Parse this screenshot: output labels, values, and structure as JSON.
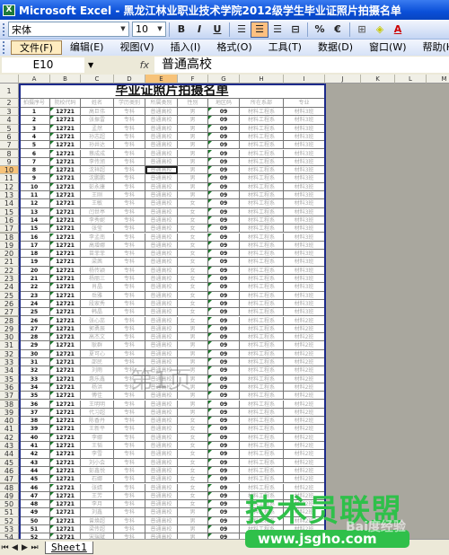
{
  "window": {
    "title": "Microsoft Excel - 黑龙江林业职业技术学院2012级学生毕业证照片拍摄名单",
    "app_icon": "excel-icon"
  },
  "format_toolbar": {
    "font": "宋体",
    "size": "10",
    "bold": "B",
    "italic": "I",
    "underline": "U",
    "percent": "%",
    "euro": "€"
  },
  "menu": [
    "文件(F)",
    "编辑(E)",
    "视图(V)",
    "插入(I)",
    "格式(O)",
    "工具(T)",
    "数据(D)",
    "窗口(W)",
    "帮助(H)"
  ],
  "formula_bar": {
    "name_box": "E10",
    "fx": "fx",
    "value": "普通高校"
  },
  "columns": [
    "A",
    "B",
    "C",
    "D",
    "E",
    "F",
    "G",
    "H",
    "I",
    "J",
    "K",
    "L",
    "M"
  ],
  "selected_cell": {
    "col": "E",
    "row": 10
  },
  "sheet_title": "毕业证照片拍摄名单",
  "headers": [
    "拍摄序号",
    "院校代码",
    "姓名",
    "学历类别",
    "所属类别",
    "性别",
    "地区码",
    "所在系部",
    "专业"
  ],
  "rows": [
    [
      "1",
      "12721",
      "高巨伟",
      "专科",
      "普通高校",
      "男",
      "09",
      "材料工程系",
      "材料3班"
    ],
    [
      "2",
      "12721",
      "张振雷",
      "专科",
      "普通高校",
      "男",
      "09",
      "材料工程系",
      "材料3班"
    ],
    [
      "3",
      "12721",
      "孟然",
      "专科",
      "普通高校",
      "男",
      "09",
      "材料工程系",
      "材料3班"
    ],
    [
      "4",
      "12721",
      "孙志超",
      "专科",
      "普通高校",
      "男",
      "09",
      "材料工程系",
      "材料3班"
    ],
    [
      "5",
      "12721",
      "孙井达",
      "专科",
      "普通高校",
      "男",
      "09",
      "材料工程系",
      "材料3班"
    ],
    [
      "6",
      "12721",
      "蔡成成",
      "专科",
      "普通高校",
      "男",
      "09",
      "材料工程系",
      "材料3班"
    ],
    [
      "7",
      "12721",
      "李传旭",
      "专科",
      "普通高校",
      "男",
      "09",
      "材料工程系",
      "材料3班"
    ],
    [
      "8",
      "12721",
      "沈祥超",
      "专科",
      "普通高校",
      "男",
      "09",
      "材料工程系",
      "材料3班"
    ],
    [
      "9",
      "12721",
      "沈鹏鹏",
      "专科",
      "普通高校",
      "男",
      "09",
      "材料工程系",
      "材料3班"
    ],
    [
      "10",
      "12721",
      "彭永康",
      "专科",
      "普通高校",
      "男",
      "09",
      "材料工程系",
      "材料3班"
    ],
    [
      "11",
      "12721",
      "王刚",
      "专科",
      "普通高校",
      "男",
      "09",
      "材料工程系",
      "材料3班"
    ],
    [
      "12",
      "12721",
      "王敏",
      "专科",
      "普通高校",
      "女",
      "09",
      "材料工程系",
      "材料3班"
    ],
    [
      "13",
      "12721",
      "闫世亭",
      "专科",
      "普通高校",
      "女",
      "09",
      "材料工程系",
      "材料3班"
    ],
    [
      "14",
      "12721",
      "李秀妮",
      "专科",
      "普通高校",
      "女",
      "09",
      "材料工程系",
      "材料3班"
    ],
    [
      "15",
      "12721",
      "张莹",
      "专科",
      "普通高校",
      "女",
      "09",
      "材料工程系",
      "材料3班"
    ],
    [
      "16",
      "12721",
      "李孟南",
      "专科",
      "普通高校",
      "女",
      "09",
      "材料工程系",
      "材料3班"
    ],
    [
      "17",
      "12721",
      "高增娜",
      "专科",
      "普通高校",
      "女",
      "09",
      "材料工程系",
      "材料3班"
    ],
    [
      "18",
      "12721",
      "苗菲菲",
      "专科",
      "普通高校",
      "女",
      "09",
      "材料工程系",
      "材料3班"
    ],
    [
      "19",
      "12721",
      "梁茜",
      "专科",
      "普通高校",
      "女",
      "09",
      "材料工程系",
      "材料3班"
    ],
    [
      "20",
      "12721",
      "杨传颖",
      "专科",
      "普通高校",
      "女",
      "09",
      "材料工程系",
      "材料3班"
    ],
    [
      "21",
      "12721",
      "杨丽三",
      "专科",
      "普通高校",
      "女",
      "09",
      "材料工程系",
      "材料3班"
    ],
    [
      "22",
      "12721",
      "肖晶",
      "专科",
      "普通高校",
      "女",
      "09",
      "材料工程系",
      "材料3班"
    ],
    [
      "23",
      "12721",
      "岳雅",
      "专科",
      "普通高校",
      "女",
      "09",
      "材料工程系",
      "材料3班"
    ],
    [
      "24",
      "12721",
      "段家秀",
      "专科",
      "普通高校",
      "女",
      "09",
      "材料工程系",
      "材料3班"
    ],
    [
      "25",
      "12721",
      "韩晶",
      "专科",
      "普通高校",
      "女",
      "09",
      "材料工程系",
      "材料3班"
    ],
    [
      "26",
      "12721",
      "张心蕊",
      "专科",
      "普通高校",
      "女",
      "09",
      "材料工程系",
      "材料2班"
    ],
    [
      "27",
      "12721",
      "郭勇辰",
      "专科",
      "普通高校",
      "男",
      "09",
      "材料工程系",
      "材料2班"
    ],
    [
      "28",
      "12721",
      "高杰文",
      "专科",
      "普通高校",
      "男",
      "09",
      "材料工程系",
      "材料2班"
    ],
    [
      "29",
      "12721",
      "耿群",
      "专科",
      "普通高校",
      "男",
      "09",
      "材料工程系",
      "材料2班"
    ],
    [
      "30",
      "12721",
      "夏可心",
      "专科",
      "普通高校",
      "男",
      "09",
      "材料工程系",
      "材料2班"
    ],
    [
      "31",
      "12721",
      "邵民",
      "专科",
      "普通高校",
      "男",
      "09",
      "材料工程系",
      "材料2班"
    ],
    [
      "32",
      "12721",
      "刘雨",
      "专科",
      "普通高校",
      "男",
      "09",
      "材料工程系",
      "材料2班"
    ],
    [
      "33",
      "12721",
      "惠乐鑫",
      "专科",
      "普通高校",
      "男",
      "09",
      "材料工程系",
      "材料2班"
    ],
    [
      "34",
      "12721",
      "杨洪",
      "专科",
      "普通高校",
      "男",
      "09",
      "材料工程系",
      "材料2班"
    ],
    [
      "35",
      "12721",
      "傅佳",
      "专科",
      "普通高校",
      "男",
      "09",
      "材料工程系",
      "材料2班"
    ],
    [
      "36",
      "12721",
      "王明明",
      "专科",
      "普通高校",
      "男",
      "09",
      "材料工程系",
      "材料2班"
    ],
    [
      "37",
      "12721",
      "代习超",
      "专科",
      "普通高校",
      "男",
      "09",
      "材料工程系",
      "材料2班"
    ],
    [
      "38",
      "12721",
      "陈香丹",
      "专科",
      "普通高校",
      "女",
      "09",
      "材料工程系",
      "材料2班"
    ],
    [
      "39",
      "12721",
      "王新平",
      "专科",
      "普通高校",
      "女",
      "09",
      "材料工程系",
      "材料2班"
    ],
    [
      "40",
      "12721",
      "李娜",
      "专科",
      "普通高校",
      "女",
      "09",
      "材料工程系",
      "材料2班"
    ],
    [
      "41",
      "12721",
      "王韬",
      "专科",
      "普通高校",
      "女",
      "09",
      "材料工程系",
      "材料2班"
    ],
    [
      "42",
      "12721",
      "李雪",
      "专科",
      "普通高校",
      "女",
      "09",
      "材料工程系",
      "材料2班"
    ],
    [
      "43",
      "12721",
      "刘小会",
      "专科",
      "普通高校",
      "女",
      "09",
      "材料工程系",
      "材料2班"
    ],
    [
      "44",
      "12721",
      "彭鑫悦",
      "专科",
      "普通高校",
      "女",
      "09",
      "材料工程系",
      "材料2班"
    ],
    [
      "45",
      "12721",
      "石娜",
      "专科",
      "普通高校",
      "女",
      "09",
      "材料工程系",
      "材料2班"
    ],
    [
      "46",
      "12721",
      "张婧",
      "专科",
      "普通高校",
      "女",
      "09",
      "材料工程系",
      "材料2班"
    ],
    [
      "47",
      "12721",
      "王芳",
      "专科",
      "普通高校",
      "女",
      "09",
      "材料工程系",
      "材料2班"
    ],
    [
      "48",
      "12721",
      "李月",
      "专科",
      "普通高校",
      "女",
      "09",
      "材料工程系",
      "材料2班"
    ],
    [
      "49",
      "12721",
      "刘鑫",
      "专科",
      "普通高校",
      "男",
      "09",
      "材料工程系",
      "材料2班"
    ],
    [
      "50",
      "12721",
      "曾焕超",
      "专科",
      "普通高校",
      "男",
      "09",
      "材料工程系",
      "材料2班"
    ],
    [
      "51",
      "12721",
      "梁传超",
      "专科",
      "普通高校",
      "男",
      "09",
      "材料工程系",
      "材料2班"
    ],
    [
      "52",
      "12721",
      "宋瑞斌",
      "专科",
      "普通高校",
      "男",
      "09",
      "材料工程系",
      "材料2班"
    ]
  ],
  "page_watermark": "第1页",
  "sheet_tabs": [
    "Sheet1"
  ],
  "watermark": {
    "brand": "技术员联盟",
    "url": "www.jsgho.com",
    "secondary": "Bai度经验"
  },
  "colors": {
    "print_border": "#1c2a8a",
    "selection_header": "#f7c37a",
    "error_triangle": "#1a7a2a",
    "watermark_green": "#2fc04a"
  }
}
